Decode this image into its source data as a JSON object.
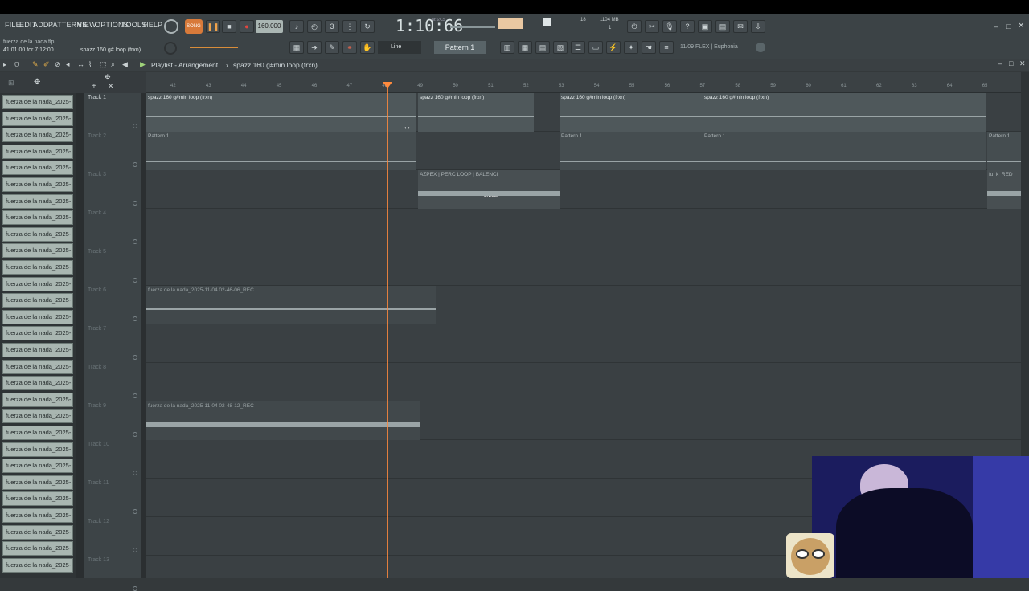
{
  "menu": [
    "FILE",
    "EDIT",
    "ADD",
    "PATTERNS",
    "VIEW",
    "OPTIONS",
    "TOOLS",
    "HELP"
  ],
  "file_info": {
    "name": "fuerza de la nada.flp",
    "time": "41:01:00 for 7:12:00",
    "hint": "spazz 160 g# loop (frxn)"
  },
  "transport": {
    "song_label": "SONG",
    "tempo": "160.000",
    "time_display": "1:10:66",
    "time_unit": "M:S:CS"
  },
  "system": {
    "cpu": "18",
    "memory": "1104 MB",
    "polyphony": "1"
  },
  "toolbar": {
    "snap": "Line",
    "pattern": "Pattern 1",
    "plugin_info": "11/09 FLEX | Euphonia"
  },
  "playlist": {
    "title": "Playlist - Arrangement",
    "breadcrumb": "spazz 160 g#min loop (frxn)"
  },
  "ruler_ticks": [
    "42",
    "43",
    "44",
    "45",
    "46",
    "47",
    "48",
    "49",
    "50",
    "51",
    "52",
    "53",
    "54",
    "55",
    "56",
    "57",
    "58",
    "59",
    "60",
    "61",
    "62",
    "63",
    "64",
    "65"
  ],
  "pattern_items": [
    "fuerza de la nada_2025-",
    "fuerza de la nada_2025-",
    "fuerza de la nada_2025-",
    "fuerza de la nada_2025-",
    "fuerza de la nada_2025-",
    "fuerza de la nada_2025-",
    "fuerza de la nada_2025-",
    "fuerza de la nada_2025-",
    "fuerza de la nada_2025-",
    "fuerza de la nada_2025-",
    "fuerza de la nada_2025-",
    "fuerza de la nada_2025-",
    "fuerza de la nada_2025-",
    "fuerza de la nada_2025-",
    "fuerza de la nada_2025-",
    "fuerza de la nada_2025-",
    "fuerza de la nada_2025-",
    "fuerza de la nada_2025-",
    "fuerza de la nada_2025-",
    "fuerza de la nada_2025-",
    "fuerza de la nada_2025-",
    "fuerza de la nada_2025-",
    "fuerza de la nada_2025-",
    "fuerza de la nada_2025-",
    "fuerza de la nada_2025-",
    "fuerza de la nada_2025-",
    "fuerza de la nada_2025-",
    "fuerza de la nada_2025-",
    "fuerza de la nada_2025-"
  ],
  "tracks": [
    "Track 1",
    "Track 2",
    "Track 3",
    "Track 4",
    "Track 5",
    "Track 6",
    "Track 7",
    "Track 8",
    "Track 9",
    "Track 10",
    "Track 11",
    "Track 12",
    "Track 13"
  ],
  "clips": {
    "track1_a": "spazz 160 g#min loop (frxn)",
    "track1_b": "spazz 160 g#min loop (frxn)",
    "track1_c": "spazz 160 g#min loop (frxn)",
    "track1_d": "spazz 160 g#min loop (frxn)",
    "track2_a": "Pattern 1",
    "track2_b": "Pattern 1",
    "track2_c": "Pattern 1",
    "track2_d": "Pattern 1",
    "track3_a": "AZPEX | PERC LOOP | BALENCI",
    "track3_gain": "-2.2dB",
    "track3_b": "fu_k_RED",
    "track6": "fuerza de la nada_2025-11-04 02-46-06_REC",
    "track9": "fuerza de la nada_2025-11-04 02-48-12_REC"
  }
}
